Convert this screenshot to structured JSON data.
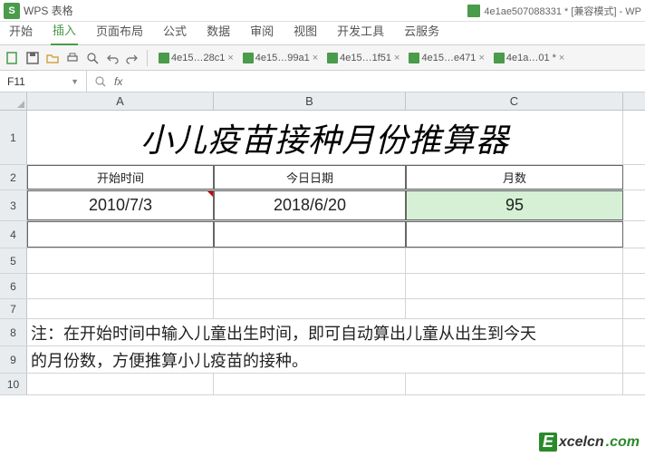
{
  "app": {
    "logo": "S",
    "name": "WPS 表格"
  },
  "title": {
    "doc": "4e1ae507088331 * [兼容模式] - WP"
  },
  "menu": {
    "start": "开始",
    "insert": "插入",
    "layout": "页面布局",
    "formula": "公式",
    "data": "数据",
    "review": "审阅",
    "view": "视图",
    "dev": "开发工具",
    "cloud": "云服务"
  },
  "doctabs": {
    "t1": "4e15…28c1",
    "t2": "4e15…99a1",
    "t3": "4e15…1f51",
    "t4": "4e15…e471",
    "t5": "4e1a…01 *"
  },
  "namebox": "F11",
  "fx": "fx",
  "cols": {
    "A": "A",
    "B": "B",
    "C": "C"
  },
  "rows": {
    "r1": "1",
    "r2": "2",
    "r3": "3",
    "r4": "4",
    "r5": "5",
    "r6": "6",
    "r7": "7",
    "r8": "8",
    "r9": "9",
    "r10": "10"
  },
  "cells": {
    "title": "小儿疫苗接种月份推算器",
    "h_start": "开始时间",
    "h_today": "今日日期",
    "h_months": "月数",
    "v_start": "2010/7/3",
    "v_today": "2018/6/20",
    "v_months": "95",
    "note1": "注：在开始时间中输入儿童出生时间，即可自动算出儿童从出生到今天",
    "note2": "的月份数，方便推算小儿疫苗的接种。"
  },
  "watermark": {
    "e": "E",
    "text1": "xcelcn",
    "text2": ".com"
  }
}
